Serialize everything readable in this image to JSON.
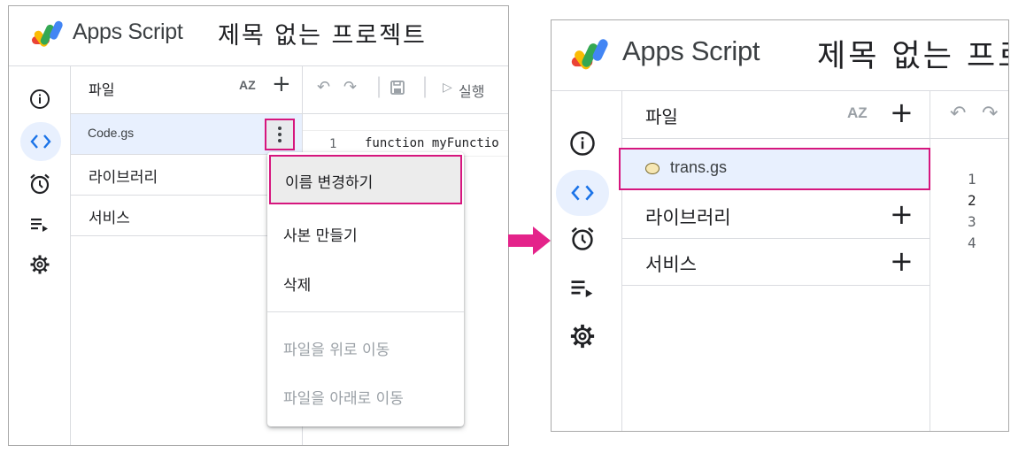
{
  "colors": {
    "highlight": "#d6167e",
    "selected_bg": "#e8f0fe",
    "arrow": "#e4238a"
  },
  "left": {
    "app_title": "Apps Script",
    "project_title": "제목 없는 프로젝트",
    "rail_icons": [
      "info-icon",
      "code-icon",
      "alarm-icon",
      "executions-icon",
      "gear-icon"
    ],
    "files_label": "파일",
    "sort_icon_label": "AZ",
    "add_label": "+",
    "file_name": "Code.gs",
    "libraries_label": "라이브러리",
    "services_label": "서비스",
    "run_label": "실행",
    "line_number": "1",
    "code_text": "function myFunctio",
    "context_menu": {
      "rename": "이름 변경하기",
      "copy": "사본 만들기",
      "delete": "삭제",
      "move_up": "파일을 위로 이동",
      "move_down": "파일을 아래로 이동"
    }
  },
  "right": {
    "app_title": "Apps Script",
    "project_title": "제목 없는 프로",
    "rail_icons": [
      "info-icon",
      "code-icon",
      "alarm-icon",
      "executions-icon",
      "gear-icon"
    ],
    "files_label": "파일",
    "sort_icon_label": "AZ",
    "add_label": "+",
    "file_name": "trans.gs",
    "libraries_label": "라이브러리",
    "services_label": "서비스",
    "line_numbers": [
      "1",
      "2",
      "3",
      "4"
    ]
  }
}
